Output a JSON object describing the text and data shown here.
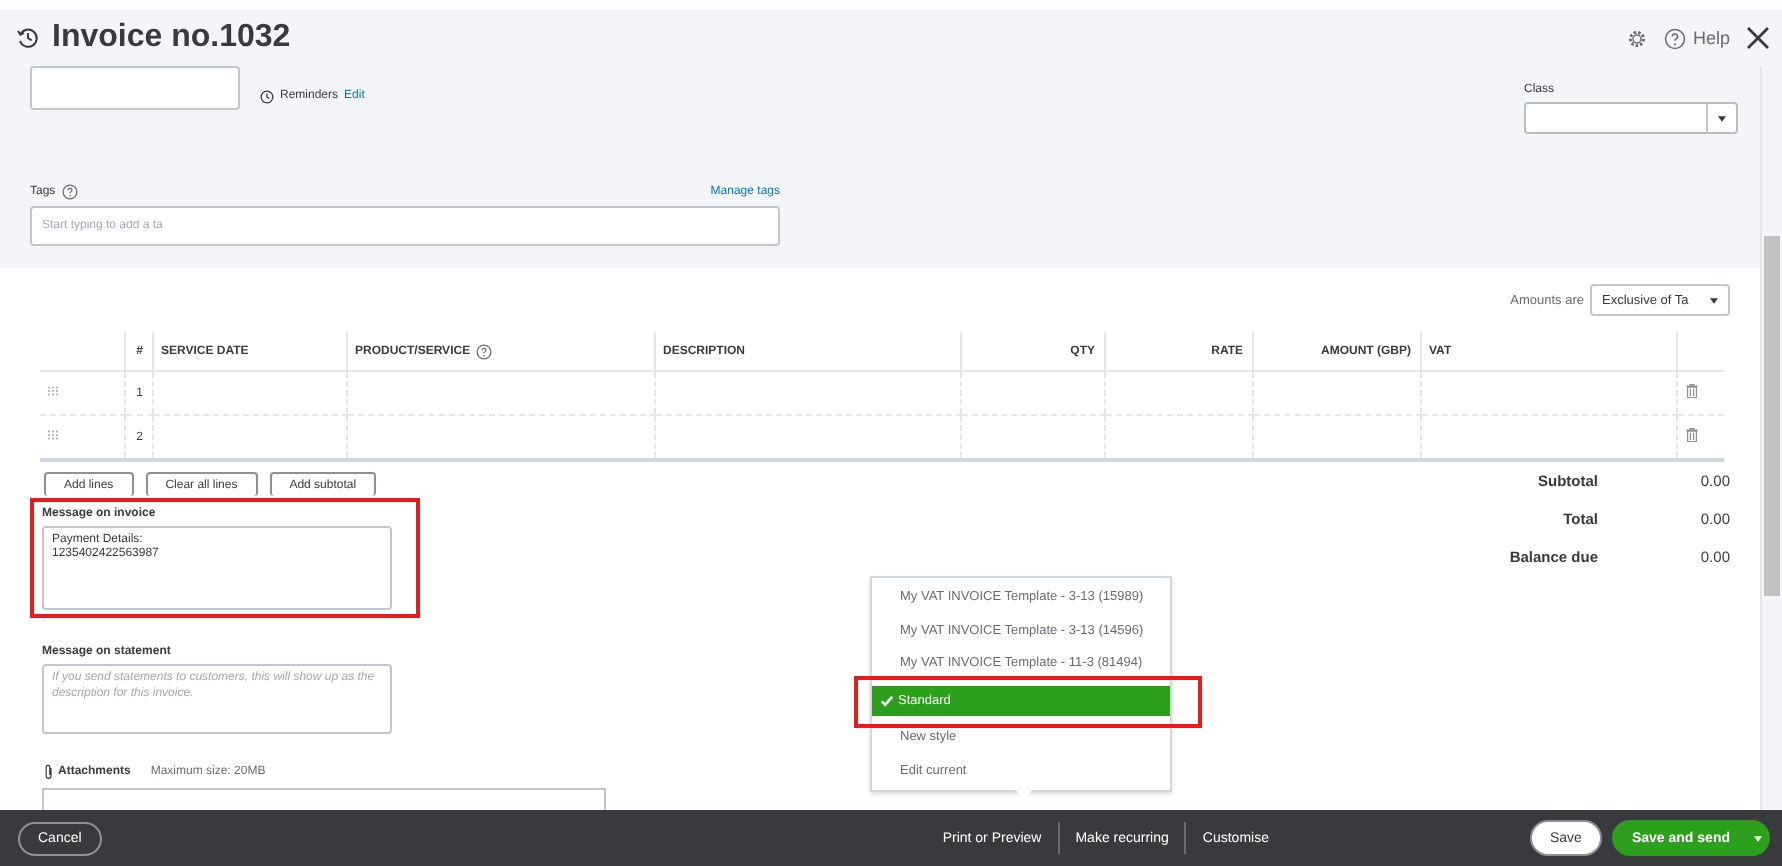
{
  "header": {
    "title": "Invoice no.1032",
    "help": "Help"
  },
  "top": {
    "reminders": "Reminders",
    "reminders_edit": "Edit",
    "class_label": "Class",
    "tags_label": "Tags",
    "manage_tags": "Manage tags",
    "tags_placeholder": "Start typing to add a ta"
  },
  "amounts": {
    "label": "Amounts are",
    "value": "Exclusive of Ta"
  },
  "table": {
    "columns": [
      "#",
      "SERVICE DATE",
      "PRODUCT/SERVICE",
      "DESCRIPTION",
      "QTY",
      "RATE",
      "AMOUNT (GBP)",
      "VAT"
    ],
    "rows": [
      {
        "number": "1"
      },
      {
        "number": "2"
      }
    ]
  },
  "line_buttons": [
    "Add lines",
    "Clear all lines",
    "Add subtotal"
  ],
  "totals": [
    {
      "label": "Subtotal",
      "value": "0.00"
    },
    {
      "label": "Total",
      "value": "0.00"
    },
    {
      "label": "Balance due",
      "value": "0.00"
    }
  ],
  "message_invoice": {
    "label": "Message on invoice",
    "value": "Payment Details:\n1235402422563987",
    "highlighted": true
  },
  "message_statement": {
    "label": "Message on statement",
    "placeholder": "If you send statements to customers, this will show up as the description for this invoice."
  },
  "attachments": {
    "label": "Attachments",
    "note": "Maximum size: 20MB"
  },
  "style_menu": {
    "items": [
      {
        "label": "My VAT INVOICE Template - 3-13 (15989)",
        "selected": false,
        "highlighted": false
      },
      {
        "label": "My VAT INVOICE Template - 3-13 (14596)",
        "selected": false,
        "highlighted": false
      },
      {
        "label": "My VAT INVOICE Template - 11-3 (81494)",
        "selected": false,
        "highlighted": false
      },
      {
        "label": "Standard",
        "selected": true,
        "highlighted": true
      },
      {
        "label": "New style",
        "selected": false,
        "highlighted": false
      },
      {
        "label": "Edit current",
        "selected": false,
        "highlighted": false
      }
    ]
  },
  "footer": {
    "cancel": "Cancel",
    "actions": [
      "Print or Preview",
      "Make recurring",
      "Customise"
    ],
    "save": "Save",
    "save_and_send": "Save and send"
  }
}
